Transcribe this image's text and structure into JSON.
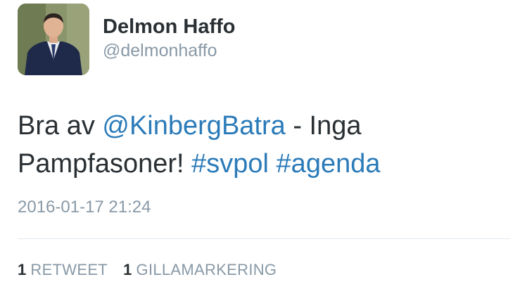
{
  "user": {
    "name": "Delmon Haffo",
    "handle": "@delmonhaffo"
  },
  "tweet": {
    "text_1": "Bra av ",
    "mention": "@KinbergBatra",
    "text_2": "  - Inga Pampfasoner! ",
    "hashtag_1": "#svpol",
    "hashtag_2": "#agenda",
    "timestamp": "2016-01-17 21:24"
  },
  "stats": {
    "retweet_count": "1",
    "retweet_label": "RETWEET",
    "like_count": "1",
    "like_label": "GILLAMARKERING"
  },
  "colors": {
    "link": "#2b7bb9",
    "secondary_text": "#8899a6",
    "primary_text": "#292f33"
  }
}
